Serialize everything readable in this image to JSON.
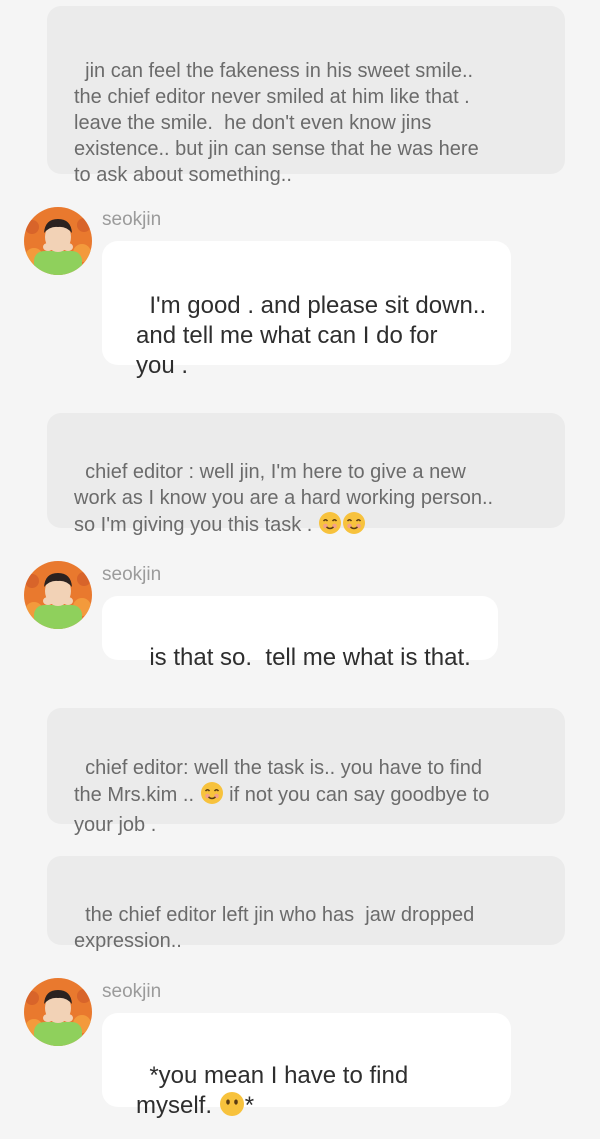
{
  "messages": [
    {
      "type": "narration",
      "text": "jin can feel the fakeness in his sweet smile..\nthe chief editor never smiled at him like that .\nleave the smile.  he don't even know jins\nexistence.. but jin can sense that he was here\nto ask about something.."
    },
    {
      "type": "character",
      "speaker": "seokjin",
      "text": "I'm good . and please sit down..\nand tell me what can I do for\nyou ."
    },
    {
      "type": "narration",
      "text": "chief editor : well jin, I'm here to give a new\nwork as I know you are a hard working person..\nso I'm giving you this task . ",
      "emoji": [
        "smiling-face-emoji",
        "smiling-face-emoji"
      ]
    },
    {
      "type": "character",
      "speaker": "seokjin",
      "text": "is that so.  tell me what is that."
    },
    {
      "type": "narration",
      "text_before": "chief editor: well the task is.. you have to find\nthe Mrs.kim .. ",
      "text_after": " if not you can say goodbye to\nyour job .",
      "emoji": [
        "smiling-face-emoji"
      ]
    },
    {
      "type": "narration",
      "text": "the chief editor left jin who has  jaw dropped\nexpression.."
    },
    {
      "type": "character",
      "speaker": "seokjin",
      "text_before": "*you mean I have to find\nmyself. ",
      "text_after": "*",
      "emoji": [
        "face-without-mouth-emoji"
      ]
    }
  ],
  "colors": {
    "background": "#f5f5f5",
    "narration_bubble": "#ebebeb",
    "character_bubble": "#ffffff",
    "narration_text": "#6b6b6b",
    "character_text": "#2e2e2e",
    "speaker_name": "#9b9b9b",
    "emoji_yellow": "#f7c23d"
  }
}
